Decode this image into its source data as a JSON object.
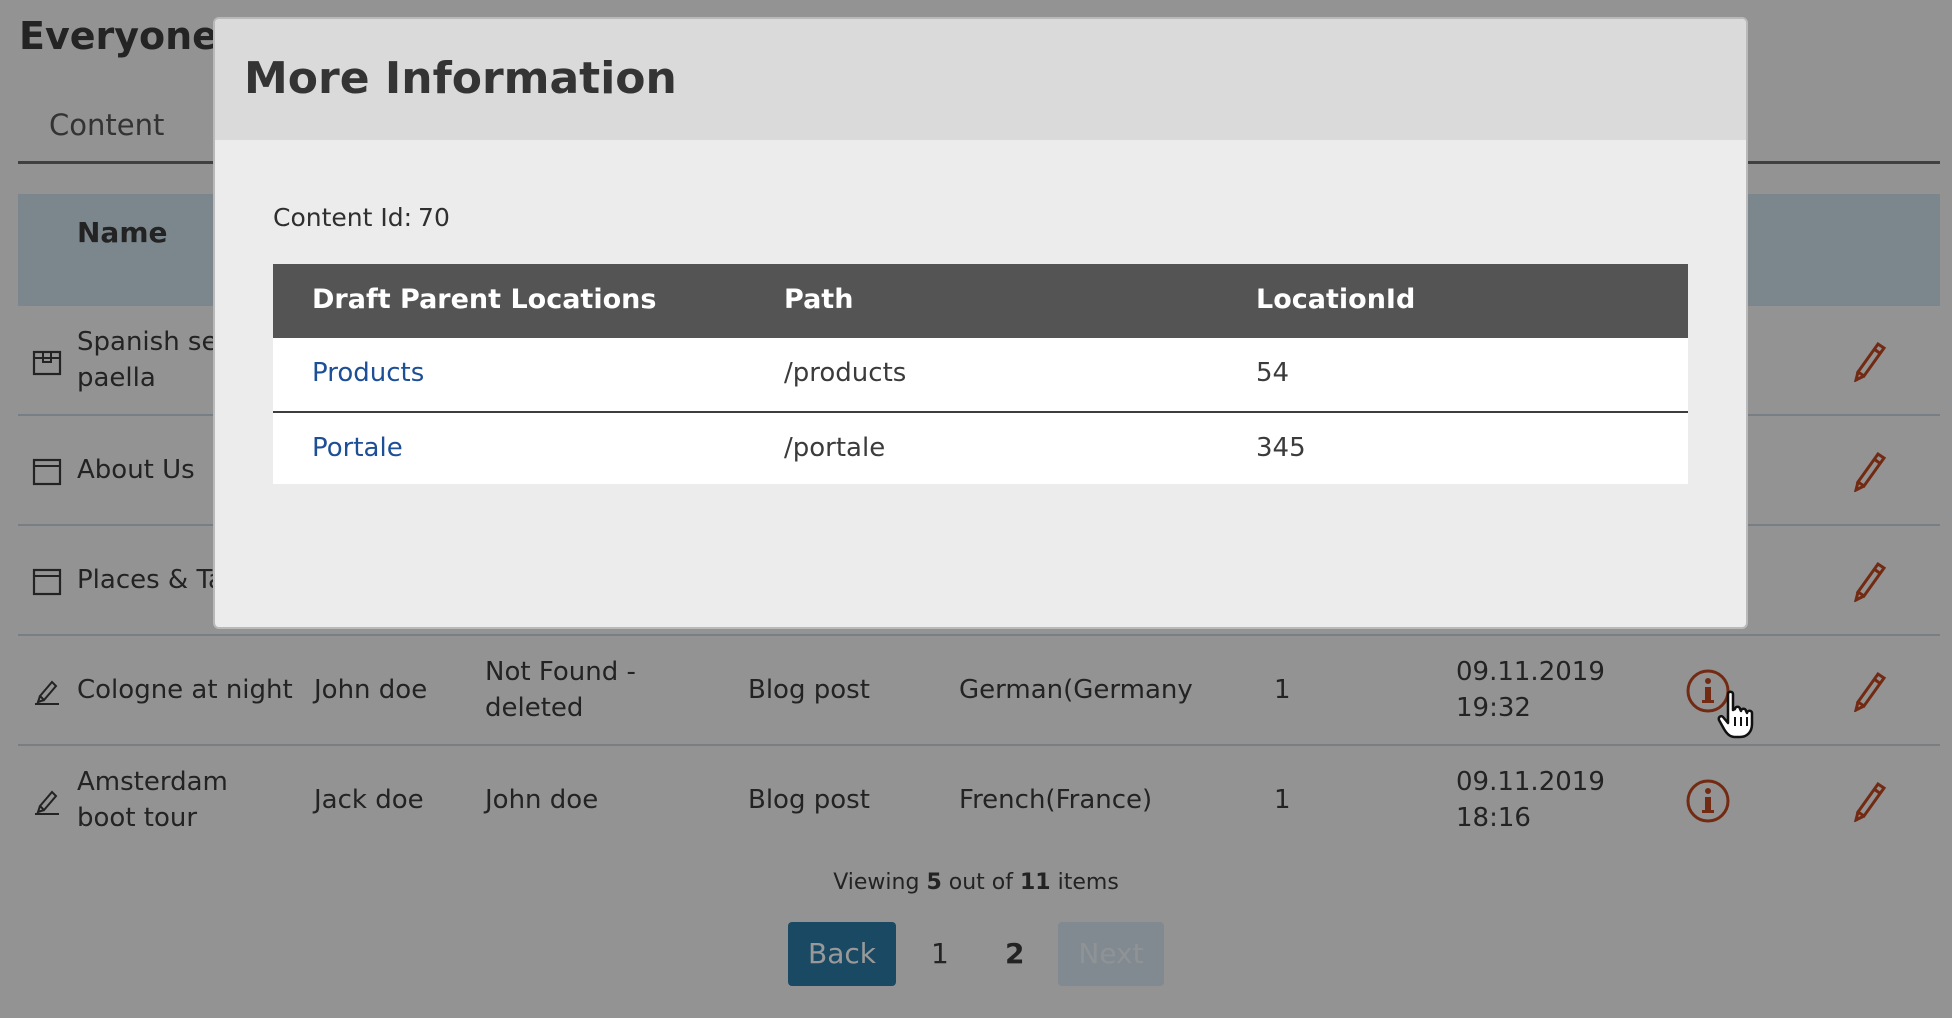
{
  "page": {
    "title": "Everyone"
  },
  "tabs": [
    {
      "label": "Content"
    }
  ],
  "list": {
    "columns": {
      "name": "Name"
    },
    "rows": [
      {
        "name_lines": [
          "Spanish sea",
          "paella"
        ],
        "type_icon": "product-box-icon"
      },
      {
        "name_lines": [
          "About Us"
        ],
        "type_icon": "page-window-icon"
      },
      {
        "name_lines": [
          "Places & Tas"
        ],
        "type_icon": "page-window-icon"
      },
      {
        "name_lines": [
          "Cologne at night"
        ],
        "type_icon": "blog-pen-icon",
        "author": "John doe",
        "modifier_lines": [
          "Not Found -",
          "deleted"
        ],
        "content_type": "Blog post",
        "language": "German(Germany",
        "version": "1",
        "modified_lines": [
          "09.11.2019",
          "19:32"
        ]
      },
      {
        "name_lines": [
          "Amsterdam",
          "boot tour"
        ],
        "type_icon": "blog-pen-icon",
        "author": "Jack doe",
        "modifier_lines": [
          "John doe"
        ],
        "content_type": "Blog post",
        "language": "French(France)",
        "version": "1",
        "modified_lines": [
          "09.11.2019",
          "18:16"
        ]
      }
    ]
  },
  "pagination": {
    "viewing_prefix": "Viewing",
    "viewing_count": "5",
    "viewing_mid": "out of",
    "viewing_total": "11",
    "viewing_suffix": "items",
    "back_label": "Back",
    "pages": [
      "1",
      "2"
    ],
    "current_page": "2",
    "next_label": "Next"
  },
  "modal": {
    "title": "More Information",
    "content_id_label": "Content Id:",
    "content_id_value": "70",
    "table": {
      "headers": [
        "Draft Parent Locations",
        "Path",
        "LocationId"
      ],
      "rows": [
        {
          "location": "Products",
          "path": "/products",
          "location_id": "54"
        },
        {
          "location": "Portale",
          "path": "/portale",
          "location_id": "345"
        }
      ]
    }
  },
  "colors": {
    "accent": "#c0461e",
    "link": "#1d4f97",
    "primary_button": "#2a7aa6",
    "table_header": "#545454"
  }
}
